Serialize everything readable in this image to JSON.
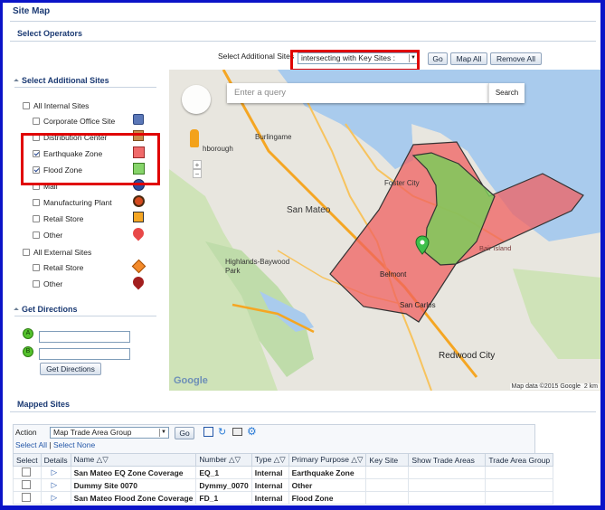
{
  "page": {
    "title": "Site Map"
  },
  "operators": {
    "heading": "Select Operators",
    "select_label": "Select Additional Sites",
    "select_value": "intersecting with Key Sites :",
    "go_label": "Go",
    "map_all_label": "Map All",
    "remove_all_label": "Remove All"
  },
  "sites": {
    "heading": "Select Additional Sites",
    "internal_label": "All Internal Sites",
    "internal_items": [
      {
        "label": "Corporate Office Site",
        "checked": false,
        "icon": "building-icon"
      },
      {
        "label": "Distribution Center",
        "checked": false,
        "icon": "box-icon"
      },
      {
        "label": "Earthquake Zone",
        "checked": true,
        "icon": "red-square-icon"
      },
      {
        "label": "Flood Zone",
        "checked": true,
        "icon": "green-square-icon"
      },
      {
        "label": "Mall",
        "checked": false,
        "icon": "globe-icon"
      },
      {
        "label": "Manufacturing Plant",
        "checked": false,
        "icon": "factory-icon"
      },
      {
        "label": "Retail Store",
        "checked": false,
        "icon": "orange-square-icon"
      },
      {
        "label": "Other",
        "checked": false,
        "icon": "red-pin-icon"
      }
    ],
    "external_label": "All External Sites",
    "external_items": [
      {
        "label": "Retail Store",
        "checked": false,
        "icon": "orange-diamond-icon"
      },
      {
        "label": "Other",
        "checked": false,
        "icon": "dark-red-pin-icon"
      }
    ]
  },
  "directions": {
    "heading": "Get Directions",
    "point_a": "A",
    "point_b": "B",
    "button_label": "Get Directions"
  },
  "map": {
    "search_placeholder": "Enter a query",
    "search_button": "Search",
    "attribution": "Map data ©2015 Google",
    "scale": "2 km",
    "logo": "Google",
    "places": [
      "Burlingame",
      "San Mateo",
      "Foster City",
      "Highlands-Baywood Park",
      "Belmont",
      "San Carlos",
      "Redwood City",
      "Bair Island",
      "hborough",
      "Hillsborough"
    ],
    "zone_colors": {
      "earthquake": "#f06060",
      "flood": "#7ccb5a"
    }
  },
  "mapped": {
    "heading": "Mapped Sites",
    "action_label": "Action",
    "action_value": "Map Trade Area Group",
    "go_label": "Go",
    "select_all": "Select All",
    "select_none": "Select None",
    "separator": "|",
    "columns": [
      "Select",
      "Details",
      "Name",
      "Number",
      "Type",
      "Primary Purpose",
      "Key Site",
      "Show Trade Areas",
      "Trade Area Group"
    ],
    "rows": [
      {
        "name": "San Mateo EQ Zone Coverage",
        "number": "EQ_1",
        "type": "Internal",
        "purpose": "Earthquake Zone"
      },
      {
        "name": "Dummy Site 0070",
        "number": "Dymmy_0070",
        "type": "Internal",
        "purpose": "Other"
      },
      {
        "name": "San Mateo Flood Zone Coverage",
        "number": "FD_1",
        "type": "Internal",
        "purpose": "Flood Zone"
      }
    ]
  }
}
